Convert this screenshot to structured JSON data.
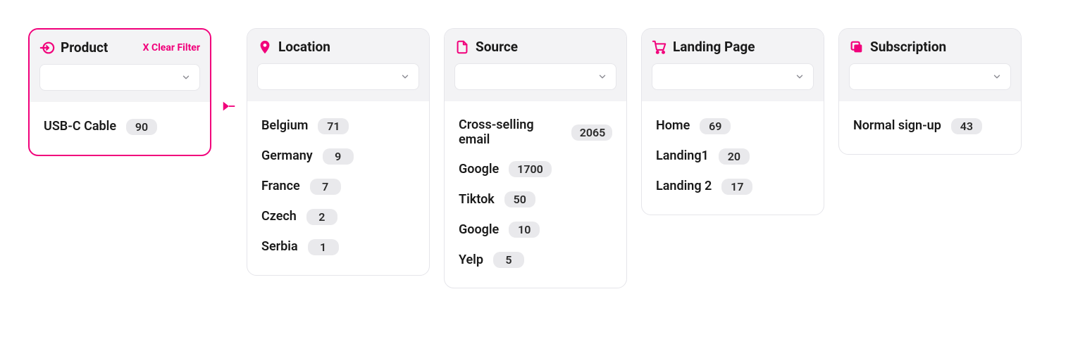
{
  "clear_filter_label": "X Clear Filter",
  "cards": [
    {
      "title": "Product",
      "active": true,
      "show_clear": true,
      "icon": "enter-icon",
      "items": [
        {
          "label": "USB-C Cable",
          "count": "90"
        }
      ]
    },
    {
      "title": "Location",
      "active": false,
      "show_clear": false,
      "icon": "pin-icon",
      "items": [
        {
          "label": "Belgium",
          "count": "71"
        },
        {
          "label": "Germany",
          "count": "9"
        },
        {
          "label": "France",
          "count": "7"
        },
        {
          "label": "Czech",
          "count": "2"
        },
        {
          "label": "Serbia",
          "count": "1"
        }
      ]
    },
    {
      "title": "Source",
      "active": false,
      "show_clear": false,
      "icon": "file-icon",
      "items": [
        {
          "label": "Cross-selling email",
          "count": "2065"
        },
        {
          "label": "Google",
          "count": "1700"
        },
        {
          "label": "Tiktok",
          "count": "50"
        },
        {
          "label": "Google",
          "count": "10"
        },
        {
          "label": "Yelp",
          "count": "5"
        }
      ]
    },
    {
      "title": "Landing Page",
      "active": false,
      "show_clear": false,
      "icon": "cart-icon",
      "items": [
        {
          "label": "Home",
          "count": "69"
        },
        {
          "label": "Landing1",
          "count": "20"
        },
        {
          "label": "Landing 2",
          "count": "17"
        }
      ]
    },
    {
      "title": "Subscription",
      "active": false,
      "show_clear": false,
      "icon": "copy-icon",
      "items": [
        {
          "label": "Normal sign-up",
          "count": "43"
        }
      ]
    }
  ]
}
